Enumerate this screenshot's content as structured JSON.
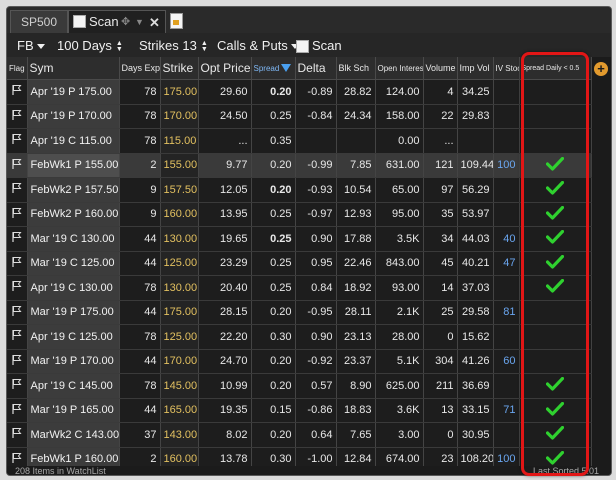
{
  "tabs": [
    {
      "label": "SP500"
    },
    {
      "label": ""
    }
  ],
  "popup": {
    "label": "Scan"
  },
  "toolbar": {
    "symbol": "FB",
    "days": "100 Days",
    "strikes": "Strikes 13",
    "type": "Calls & Puts",
    "scan_label": "Scan"
  },
  "columns": [
    "Flag",
    "Sym",
    "Days Exp",
    "Strike",
    "Opt Price",
    "Spread",
    "Delta",
    "Blk Sch",
    "Open Interest",
    "Volume",
    "Imp Vol",
    "IV Stoc",
    "Spread Daily < 0.5"
  ],
  "rows": [
    {
      "sym": "Apr '19 P 175.00",
      "days": "78",
      "strike": "175.00",
      "price": "29.60",
      "spread": "0.20",
      "spread_bold": true,
      "delta": "-0.89",
      "blk": "28.82",
      "oi": "124.00",
      "vol": "4",
      "iv": "34.25",
      "ivs": "",
      "check": false
    },
    {
      "sym": "Apr '19 P 170.00",
      "days": "78",
      "strike": "170.00",
      "price": "24.50",
      "spread": "0.25",
      "spread_bold": false,
      "delta": "-0.84",
      "blk": "24.34",
      "oi": "158.00",
      "vol": "22",
      "iv": "29.83",
      "ivs": "",
      "check": false
    },
    {
      "sym": "Apr '19 C 115.00",
      "days": "78",
      "strike": "115.00",
      "price": "...",
      "spread": "0.35",
      "spread_bold": false,
      "delta": "",
      "blk": "",
      "oi": "0.00",
      "vol": "...",
      "iv": "",
      "ivs": "",
      "check": false
    },
    {
      "sym": "FebWk1 P 155.00",
      "days": "2",
      "strike": "155.00",
      "price": "9.77",
      "spread": "0.20",
      "spread_bold": false,
      "delta": "-0.99",
      "blk": "7.85",
      "oi": "631.00",
      "vol": "121",
      "iv": "109.44",
      "ivs": "100",
      "check": true,
      "selected": true
    },
    {
      "sym": "FebWk2 P 157.50",
      "days": "9",
      "strike": "157.50",
      "price": "12.05",
      "spread": "0.20",
      "spread_bold": true,
      "delta": "-0.93",
      "blk": "10.54",
      "oi": "65.00",
      "vol": "97",
      "iv": "56.29",
      "ivs": "",
      "check": true
    },
    {
      "sym": "FebWk2 P 160.00",
      "days": "9",
      "strike": "160.00",
      "price": "13.95",
      "spread": "0.25",
      "spread_bold": false,
      "delta": "-0.97",
      "blk": "12.93",
      "oi": "95.00",
      "vol": "35",
      "iv": "53.97",
      "ivs": "",
      "check": true
    },
    {
      "sym": "Mar '19 C 130.00",
      "days": "44",
      "strike": "130.00",
      "price": "19.65",
      "spread": "0.25",
      "spread_bold": true,
      "delta": "0.90",
      "blk": "17.88",
      "oi": "3.5K",
      "vol": "34",
      "iv": "44.03",
      "ivs": "40",
      "check": true
    },
    {
      "sym": "Mar '19 C 125.00",
      "days": "44",
      "strike": "125.00",
      "price": "23.29",
      "spread": "0.25",
      "spread_bold": false,
      "delta": "0.95",
      "blk": "22.46",
      "oi": "843.00",
      "vol": "45",
      "iv": "40.21",
      "ivs": "47",
      "check": true
    },
    {
      "sym": "Apr '19 C 130.00",
      "days": "78",
      "strike": "130.00",
      "price": "20.40",
      "spread": "0.25",
      "spread_bold": false,
      "delta": "0.84",
      "blk": "18.92",
      "oi": "93.00",
      "vol": "14",
      "iv": "37.03",
      "ivs": "",
      "check": true
    },
    {
      "sym": "Mar '19 P 175.00",
      "days": "44",
      "strike": "175.00",
      "price": "28.15",
      "spread": "0.20",
      "spread_bold": false,
      "delta": "-0.95",
      "blk": "28.11",
      "oi": "2.1K",
      "vol": "25",
      "iv": "29.58",
      "ivs": "81",
      "check": false
    },
    {
      "sym": "Apr '19 C 125.00",
      "days": "78",
      "strike": "125.00",
      "price": "22.20",
      "spread": "0.30",
      "spread_bold": false,
      "delta": "0.90",
      "blk": "23.13",
      "oi": "28.00",
      "vol": "0",
      "iv": "15.62",
      "ivs": "",
      "check": false
    },
    {
      "sym": "Mar '19 P 170.00",
      "days": "44",
      "strike": "170.00",
      "price": "24.70",
      "spread": "0.20",
      "spread_bold": false,
      "delta": "-0.92",
      "blk": "23.37",
      "oi": "5.1K",
      "vol": "304",
      "iv": "41.26",
      "ivs": "60",
      "check": false
    },
    {
      "sym": "Apr '19 C 145.00",
      "days": "78",
      "strike": "145.00",
      "price": "10.99",
      "spread": "0.20",
      "spread_bold": false,
      "delta": "0.57",
      "blk": "8.90",
      "oi": "625.00",
      "vol": "211",
      "iv": "36.69",
      "ivs": "",
      "check": true
    },
    {
      "sym": "Mar '19 P 165.00",
      "days": "44",
      "strike": "165.00",
      "price": "19.35",
      "spread": "0.15",
      "spread_bold": false,
      "delta": "-0.86",
      "blk": "18.83",
      "oi": "3.6K",
      "vol": "13",
      "iv": "33.15",
      "ivs": "71",
      "check": true
    },
    {
      "sym": "MarWk2 C 143.00",
      "days": "37",
      "strike": "143.00",
      "price": "8.02",
      "spread": "0.20",
      "spread_bold": false,
      "delta": "0.64",
      "blk": "7.65",
      "oi": "3.00",
      "vol": "0",
      "iv": "30.95",
      "ivs": "",
      "check": true
    },
    {
      "sym": "FebWk1 P 160.00",
      "days": "2",
      "strike": "160.00",
      "price": "13.78",
      "spread": "0.30",
      "spread_bold": false,
      "delta": "-1.00",
      "blk": "12.84",
      "oi": "674.00",
      "vol": "23",
      "iv": "108.20",
      "ivs": "100",
      "check": true
    }
  ],
  "status": {
    "left": "208 Items in WatchList",
    "right": "Last Sorted 5:01"
  },
  "colors": {
    "accent": "#e21616",
    "check": "#2fd12f",
    "strike": "#e2c060"
  }
}
